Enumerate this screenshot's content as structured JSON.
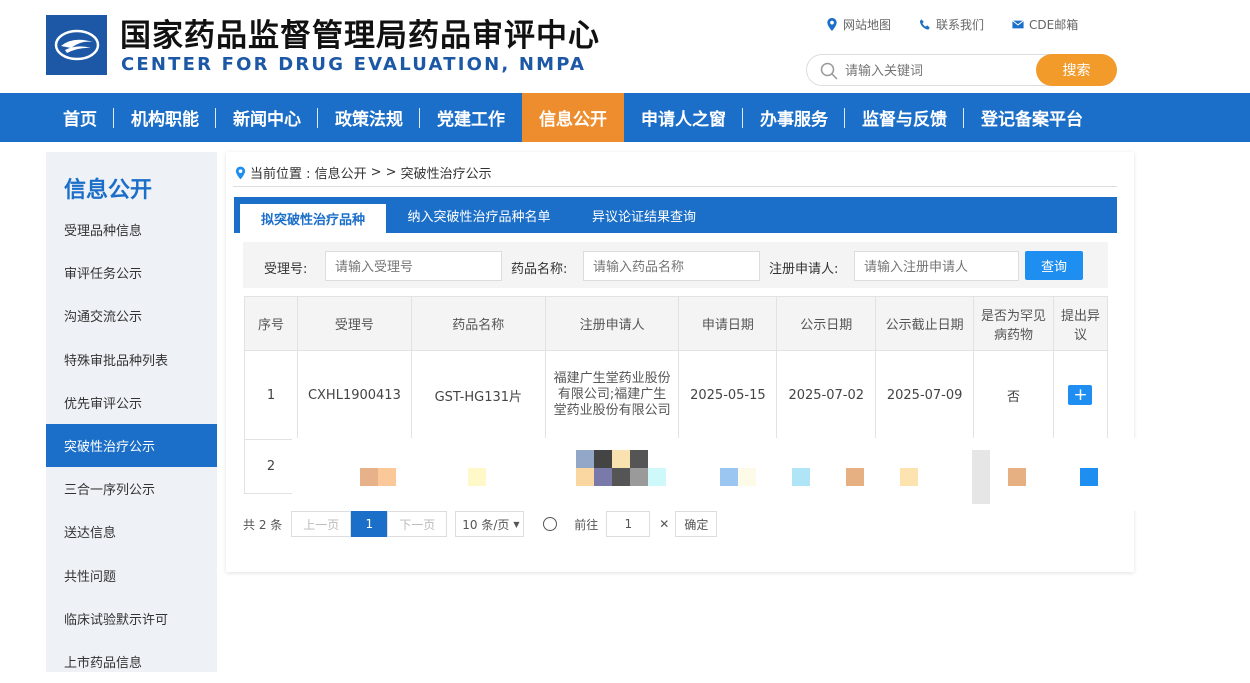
{
  "site": {
    "title_cn": "国家药品监督管理局药品审评中心",
    "title_en": "CENTER FOR DRUG EVALUATION, NMPA",
    "top_links": [
      "网站地图",
      "联系我们",
      "CDE邮箱"
    ],
    "search_placeholder": "请输入关键词",
    "search_button": "搜索",
    "brand_color": "#1c6fc9",
    "accent_color": "#ee8d2d"
  },
  "nav": [
    "首页",
    "机构职能",
    "新闻中心",
    "政策法规",
    "党建工作",
    "信息公开",
    "申请人之窗",
    "办事服务",
    "监督与反馈",
    "登记备案平台"
  ],
  "sidebar": {
    "title": "信息公开",
    "items": [
      "受理品种信息",
      "审评任务公示",
      "沟通交流公示",
      "特殊审批品种列表",
      "优先审评公示",
      "突破性治疗公示",
      "三合一序列公示",
      "送达信息",
      "共性问题",
      "临床试验默示许可",
      "上市药品信息"
    ],
    "active_index": 5
  },
  "breadcrumb": {
    "prefix": "当前位置 : 信息公开",
    "sep": "> >",
    "current": "突破性治疗公示"
  },
  "tabs": [
    "拟突破性治疗品种",
    "纳入突破性治疗品种名单",
    "异议论证结果查询"
  ],
  "filter": {
    "label1": "受理号:",
    "ph1": "请输入受理号",
    "label2": "药品名称:",
    "ph2": "请输入药品名称",
    "label3": "注册申请人:",
    "ph3": "请输入注册申请人",
    "query_button": "查询"
  },
  "table": {
    "headers": [
      "序号",
      "受理号",
      "药品名称",
      "注册申请人",
      "申请日期",
      "公示日期",
      "公示截止日期",
      "是否为罕见病药物",
      "提出异议"
    ],
    "rows": [
      {
        "no": "1",
        "acceptance_no": "CXHL1900413",
        "drug_name": "GST-HG131片",
        "applicant": "福建广生堂药业股份有限公司;福建广生堂药业股份有限公司",
        "apply_date": "2025-05-15",
        "publicity_date": "2025-07-02",
        "deadline": "2025-07-09",
        "rare_disease": "否",
        "objection": "+"
      },
      {
        "no": "2"
      }
    ]
  },
  "pager": {
    "total": "共 2 条",
    "prev": "上一页",
    "current": "1",
    "next": "下一页",
    "page_size": "10 条/页",
    "goto": "前往",
    "goto_value": "1",
    "go_button": "确定"
  }
}
